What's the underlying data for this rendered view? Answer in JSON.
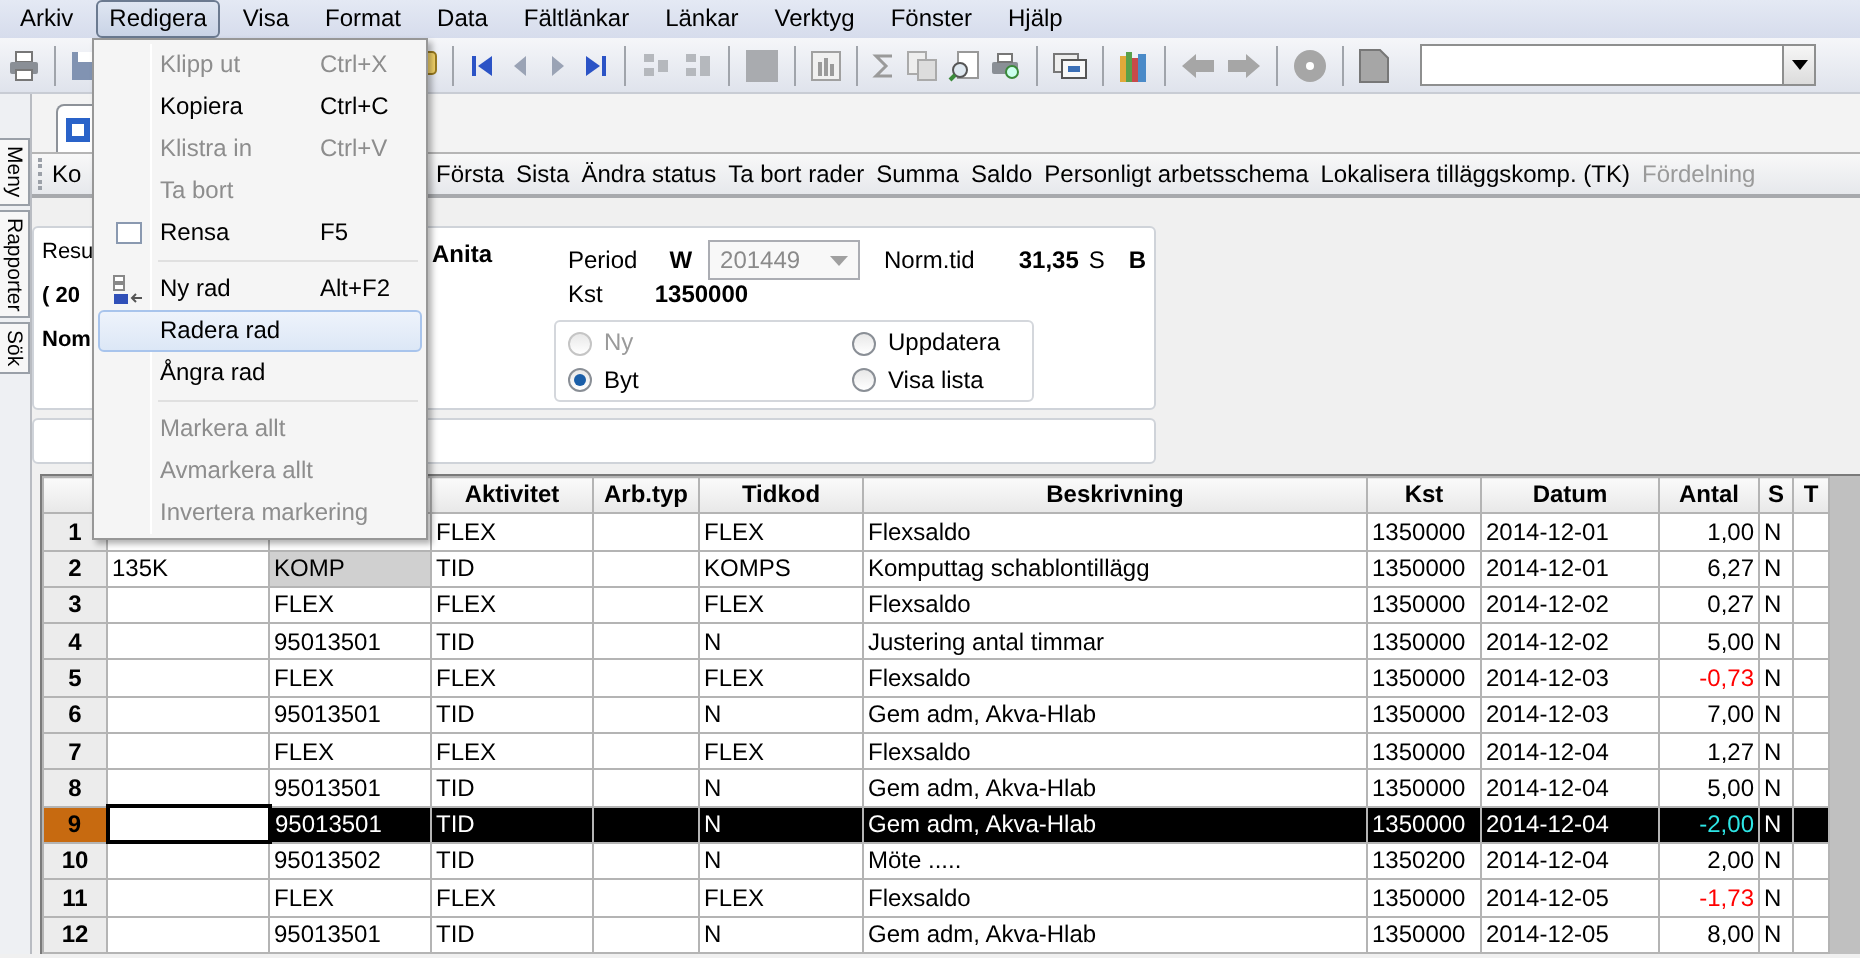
{
  "menubar": [
    {
      "label": "Arkiv",
      "open": false
    },
    {
      "label": "Redigera",
      "open": true
    },
    {
      "label": "Visa",
      "open": false
    },
    {
      "label": "Format",
      "open": false
    },
    {
      "label": "Data",
      "open": false
    },
    {
      "label": "Fältlänkar",
      "open": false
    },
    {
      "label": "Länkar",
      "open": false
    },
    {
      "label": "Verktyg",
      "open": false
    },
    {
      "label": "Fönster",
      "open": false
    },
    {
      "label": "Hjälp",
      "open": false
    }
  ],
  "edit_menu": [
    {
      "kind": "item",
      "label": "Klipp ut",
      "shortcut": "Ctrl+X",
      "disabled": true,
      "highlighted": false
    },
    {
      "kind": "item",
      "label": "Kopiera",
      "shortcut": "Ctrl+C",
      "disabled": false,
      "highlighted": false
    },
    {
      "kind": "item",
      "label": "Klistra in",
      "shortcut": "Ctrl+V",
      "disabled": true,
      "highlighted": false
    },
    {
      "kind": "item",
      "label": "Ta bort",
      "disabled": true,
      "highlighted": false
    },
    {
      "kind": "boxitem",
      "label": "Rensa",
      "shortcut": "F5",
      "disabled": false,
      "highlighted": false
    },
    {
      "kind": "separator"
    },
    {
      "kind": "insertitem",
      "label": "Ny rad",
      "shortcut": "Alt+F2",
      "disabled": false,
      "highlighted": false
    },
    {
      "kind": "item",
      "label": "Radera rad",
      "disabled": false,
      "highlighted": true
    },
    {
      "kind": "item",
      "label": "Ångra rad",
      "disabled": false,
      "highlighted": false
    },
    {
      "kind": "separator"
    },
    {
      "kind": "item",
      "label": "Markera allt",
      "disabled": true,
      "highlighted": false
    },
    {
      "kind": "item",
      "label": "Avmarkera allt",
      "disabled": true,
      "highlighted": false
    },
    {
      "kind": "item",
      "label": "Invertera markering",
      "disabled": true,
      "highlighted": false
    }
  ],
  "side_tabs": [
    {
      "label": "Meny"
    },
    {
      "label": "Rapporter"
    },
    {
      "label": "Sök"
    }
  ],
  "actions": [
    {
      "label": "Ko",
      "disabled": false
    },
    {
      "label": "Första",
      "disabled": false
    },
    {
      "label": "Sista",
      "disabled": false
    },
    {
      "label": "Ändra status",
      "disabled": false
    },
    {
      "label": "Ta bort rader",
      "disabled": false
    },
    {
      "label": "Summa",
      "disabled": false
    },
    {
      "label": "Saldo",
      "disabled": false
    },
    {
      "label": "Personligt arbetsschema",
      "disabled": false
    },
    {
      "label": "Lokalisera tilläggskomp. (TK)",
      "disabled": false
    },
    {
      "label": "Fördelning",
      "disabled": true
    }
  ],
  "form": {
    "left_texts": [
      {
        "text": "Resu",
        "bold": false
      },
      {
        "text": "( 20",
        "bold": true
      },
      {
        "text": "Nom",
        "bold": true
      }
    ],
    "name": "Anita",
    "period": {
      "label": "Period",
      "week_label": "W",
      "value": "201449",
      "disabled": true
    },
    "norm_tid": {
      "label": "Norm.tid",
      "value": "31,35",
      "unit": "S",
      "flag": "B"
    },
    "kst": {
      "label": "Kst",
      "value": "1350000"
    },
    "mode_options": [
      {
        "label": "Ny",
        "selected": false,
        "disabled": true
      },
      {
        "label": "Uppdatera",
        "selected": false,
        "disabled": false
      },
      {
        "label": "Byt",
        "selected": true,
        "disabled": false
      },
      {
        "label": "Visa lista",
        "selected": false,
        "disabled": false
      }
    ]
  },
  "table": {
    "columns": [
      "Aktivitet",
      "Arb.typ",
      "Tidkod",
      "Beskrivning",
      "Kst",
      "Datum",
      "Antal",
      "S",
      "T"
    ],
    "rows": [
      {
        "number": "1",
        "aktivitet": "FLEX",
        "tidkod": "FLEX",
        "beskrivning": "Flexsaldo",
        "kst": "1350000",
        "datum": "2014-12-01",
        "antal": "1,00",
        "s": "N",
        "negative": false,
        "selected": false,
        "column_2_marked": false
      },
      {
        "number": "2",
        "column_1": "135K",
        "column_2": "KOMP",
        "aktivitet": "TID",
        "tidkod": "KOMPS",
        "beskrivning": "Komputtag schablontillägg",
        "kst": "1350000",
        "datum": "2014-12-01",
        "antal": "6,27",
        "s": "N",
        "negative": false,
        "selected": false,
        "column_2_marked": true
      },
      {
        "number": "3",
        "column_2": "FLEX",
        "aktivitet": "FLEX",
        "tidkod": "FLEX",
        "beskrivning": "Flexsaldo",
        "kst": "1350000",
        "datum": "2014-12-02",
        "antal": "0,27",
        "s": "N",
        "negative": false,
        "selected": false,
        "column_2_marked": false
      },
      {
        "number": "4",
        "column_2": "95013501",
        "aktivitet": "TID",
        "tidkod": "N",
        "beskrivning": "Justering antal timmar",
        "kst": "1350000",
        "datum": "2014-12-02",
        "antal": "5,00",
        "s": "N",
        "negative": false,
        "selected": false,
        "column_2_marked": false
      },
      {
        "number": "5",
        "column_2": "FLEX",
        "aktivitet": "FLEX",
        "tidkod": "FLEX",
        "beskrivning": "Flexsaldo",
        "kst": "1350000",
        "datum": "2014-12-03",
        "antal": "-0,73",
        "s": "N",
        "negative": true,
        "selected": false,
        "column_2_marked": false
      },
      {
        "number": "6",
        "column_2": "95013501",
        "aktivitet": "TID",
        "tidkod": "N",
        "beskrivning": "Gem adm, Akva-Hlab",
        "kst": "1350000",
        "datum": "2014-12-03",
        "antal": "7,00",
        "s": "N",
        "negative": false,
        "selected": false,
        "column_2_marked": false
      },
      {
        "number": "7",
        "column_2": "FLEX",
        "aktivitet": "FLEX",
        "tidkod": "FLEX",
        "beskrivning": "Flexsaldo",
        "kst": "1350000",
        "datum": "2014-12-04",
        "antal": "1,27",
        "s": "N",
        "negative": false,
        "selected": false,
        "column_2_marked": false
      },
      {
        "number": "8",
        "column_2": "95013501",
        "aktivitet": "TID",
        "tidkod": "N",
        "beskrivning": "Gem adm, Akva-Hlab",
        "kst": "1350000",
        "datum": "2014-12-04",
        "antal": "5,00",
        "s": "N",
        "negative": false,
        "selected": false,
        "column_2_marked": false
      },
      {
        "number": "9",
        "column_2": "95013501",
        "aktivitet": "TID",
        "tidkod": "N",
        "beskrivning": "Gem adm, Akva-Hlab",
        "kst": "1350000",
        "datum": "2014-12-04",
        "antal": "-2,00",
        "s": "N",
        "negative": true,
        "selected": true,
        "column_2_marked": false
      },
      {
        "number": "10",
        "column_2": "95013502",
        "aktivitet": "TID",
        "tidkod": "N",
        "beskrivning": "Möte .....",
        "kst": "1350200",
        "datum": "2014-12-04",
        "antal": "2,00",
        "s": "N",
        "negative": false,
        "selected": false,
        "column_2_marked": false
      },
      {
        "number": "11",
        "column_2": "FLEX",
        "aktivitet": "FLEX",
        "tidkod": "FLEX",
        "beskrivning": "Flexsaldo",
        "kst": "1350000",
        "datum": "2014-12-05",
        "antal": "-1,73",
        "s": "N",
        "negative": true,
        "selected": false,
        "column_2_marked": false
      },
      {
        "number": "12",
        "column_2": "95013501",
        "aktivitet": "TID",
        "tidkod": "N",
        "beskrivning": "Gem adm, Akva-Hlab",
        "kst": "1350000",
        "datum": "2014-12-05",
        "antal": "8,00",
        "s": "N",
        "negative": false,
        "selected": false,
        "column_2_marked": false
      }
    ]
  }
}
